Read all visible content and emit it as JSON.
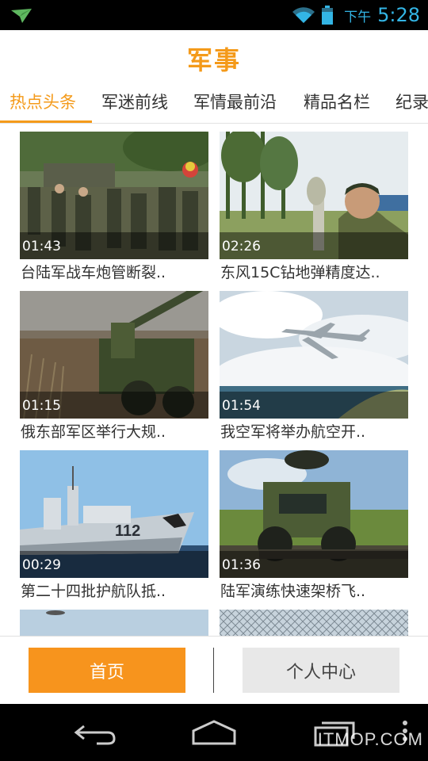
{
  "status": {
    "ampm": "下午",
    "time": "5:28"
  },
  "header": {
    "title": "军事"
  },
  "tabs": [
    {
      "label": "热点头条",
      "active": true
    },
    {
      "label": "军迷前线"
    },
    {
      "label": "军情最前沿"
    },
    {
      "label": "精品名栏"
    },
    {
      "label": "纪录"
    }
  ],
  "videos": [
    {
      "duration": "01:43",
      "title": "台陆军战车炮管断裂.."
    },
    {
      "duration": "02:26",
      "title": "东风15C钻地弹精度达.."
    },
    {
      "duration": "01:15",
      "title": "俄东部军区举行大规.."
    },
    {
      "duration": "01:54",
      "title": "我空军将举办航空开.."
    },
    {
      "duration": "00:29",
      "title": "第二十四批护航队抵.."
    },
    {
      "duration": "01:36",
      "title": "陆军演练快速架桥飞.."
    }
  ],
  "thumb_ship_number": "112",
  "bottom_nav": {
    "home": "首页",
    "profile": "个人中心"
  },
  "watermark": "ITMOP.COM",
  "colors": {
    "accent": "#f49a1a",
    "status_blue": "#33b5e5"
  }
}
